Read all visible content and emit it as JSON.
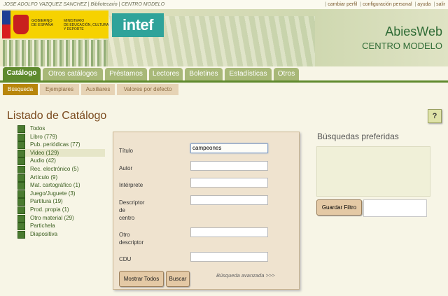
{
  "top_bar": {
    "user_info": "JOSE ADOLFO VAZQUEZ SANCHEZ | Bibliotecario | CENTRO MODELO",
    "links": [
      "cambiar perfil",
      "configuración personal",
      "ayuda",
      "salir"
    ]
  },
  "banner": {
    "gob_line1": "GOBIERNO\nDE ESPAÑA",
    "gob_line2": "MINISTERIO\nDE EDUCACIÓN, CULTURA\nY DEPORTE",
    "intef_logo": "intef",
    "app_name": "AbiesWeb",
    "center_name": "CENTRO MODELO"
  },
  "tabs": [
    "Catálogo",
    "Otros catálogos",
    "Préstamos",
    "Lectores",
    "Boletines",
    "Estadísticas",
    "Otros"
  ],
  "subtabs": [
    "Búsqueda",
    "Ejemplares",
    "Auxiliares",
    "Valores por defecto"
  ],
  "page_title": "Listado de Catálogo",
  "help_label": "?",
  "catalog_types": [
    {
      "label": "Todos",
      "icon": "stack-icon",
      "selected": false
    },
    {
      "label": "Libro (779)",
      "icon": "book-icon",
      "selected": false
    },
    {
      "label": "Pub. periódicas (77)",
      "icon": "newspaper-icon",
      "selected": false
    },
    {
      "label": "Video (129)",
      "icon": "video-icon",
      "selected": true
    },
    {
      "label": "Audio (42)",
      "icon": "audio-icon",
      "selected": false
    },
    {
      "label": "Rec. electrónico (5)",
      "icon": "disc-icon",
      "selected": false
    },
    {
      "label": "Artículo (9)",
      "icon": "article-icon",
      "selected": false
    },
    {
      "label": "Mat. cartográfico (1)",
      "icon": "globe-icon",
      "selected": false
    },
    {
      "label": "Juego/Juguete (3)",
      "icon": "game-icon",
      "selected": false
    },
    {
      "label": "Partitura (19)",
      "icon": "score-icon",
      "selected": false
    },
    {
      "label": "Prod. propia (1)",
      "icon": "own-production-icon",
      "selected": false
    },
    {
      "label": "Otro material (29)",
      "icon": "other-material-icon",
      "selected": false
    },
    {
      "label": "Partichela",
      "icon": "part-icon",
      "selected": false
    },
    {
      "label": "Diapositiva",
      "icon": "slide-icon",
      "selected": false
    }
  ],
  "search_form": {
    "title_label": "Título",
    "title_value": "campeones",
    "author_label": "Autor",
    "performer_label": "Intérprete",
    "center_descriptor_label": "Descriptor\nde\ncentro",
    "other_descriptor_label": "Otro\ndescriptor",
    "cdu_label": "CDU",
    "show_all_button": "Mostrar Todos",
    "search_button": "Buscar",
    "advanced_link": "Búsqueda avanzada >>>"
  },
  "favorites": {
    "title": "Búsquedas preferidas",
    "save_button": "Guardar Filtro",
    "filter_name_value": ""
  },
  "colors": {
    "tab_active": "#5f8a2d",
    "tab_inactive": "#a8b878",
    "subtab_active": "#b8860b",
    "title_brown": "#7a4a1e",
    "brand_green": "#2f6b35"
  }
}
